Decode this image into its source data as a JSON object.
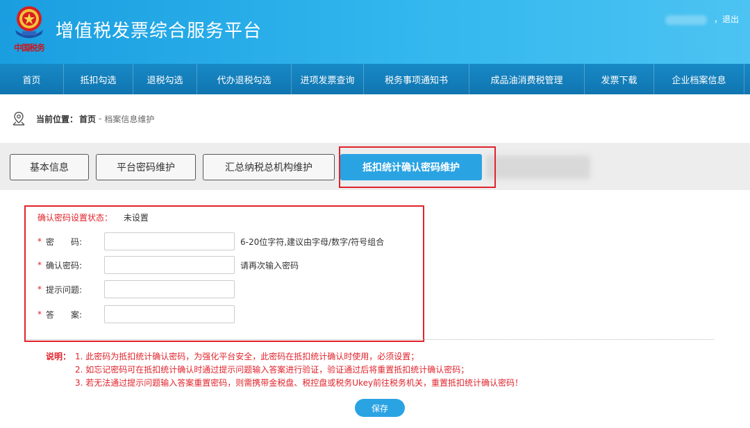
{
  "header": {
    "emblem_caption": "中国税务",
    "title": "增值税发票综合服务平台",
    "logout_label": "，退出"
  },
  "nav": {
    "items": [
      {
        "label": "首页"
      },
      {
        "label": "抵扣勾选"
      },
      {
        "label": "退税勾选"
      },
      {
        "label": "代办退税勾选"
      },
      {
        "label": "进项发票查询"
      },
      {
        "label": "税务事项通知书"
      },
      {
        "label": "成品油消费税管理"
      },
      {
        "label": "发票下载"
      },
      {
        "label": "企业档案信息"
      }
    ]
  },
  "breadcrumb": {
    "label": "当前位置：",
    "home": "首页",
    "separator": "-",
    "current": "档案信息维护"
  },
  "tabs": [
    {
      "label": "基本信息",
      "active": false
    },
    {
      "label": "平台密码维护",
      "active": false
    },
    {
      "label": "汇总纳税总机构维护",
      "active": false
    },
    {
      "label": "抵扣统计确认密码维护",
      "active": true
    }
  ],
  "form": {
    "status_label": "确认密码设置状态：",
    "status_value": "未设置",
    "required_mark": "*",
    "fields": [
      {
        "label": "密　　码:",
        "value": "",
        "hint": "6-20位字符,建议由字母/数字/符号组合"
      },
      {
        "label": "确认密码:",
        "value": "",
        "hint": "请再次输入密码"
      },
      {
        "label": "提示问题:",
        "value": "",
        "hint": ""
      },
      {
        "label": "答　　案:",
        "value": "",
        "hint": ""
      }
    ]
  },
  "notes": {
    "label": "说明：",
    "items": [
      "1. 此密码为抵扣统计确认密码，为强化平台安全，此密码在抵扣统计确认时使用，必须设置；",
      "2. 如忘记密码可在抵扣统计确认时通过提示问题输入答案进行验证，验证通过后将重置抵扣统计确认密码；",
      "3. 若无法通过提示问题输入答案重置密码，则需携带金税盘、税控盘或税务Ukey前往税务机关，重置抵扣统计确认密码！"
    ]
  },
  "save_label": "保存",
  "colors": {
    "header_blue": "#32b7ee",
    "nav_blue": "#1479b6",
    "accent": "#2aa3e3",
    "highlight_red": "#e0232b"
  }
}
